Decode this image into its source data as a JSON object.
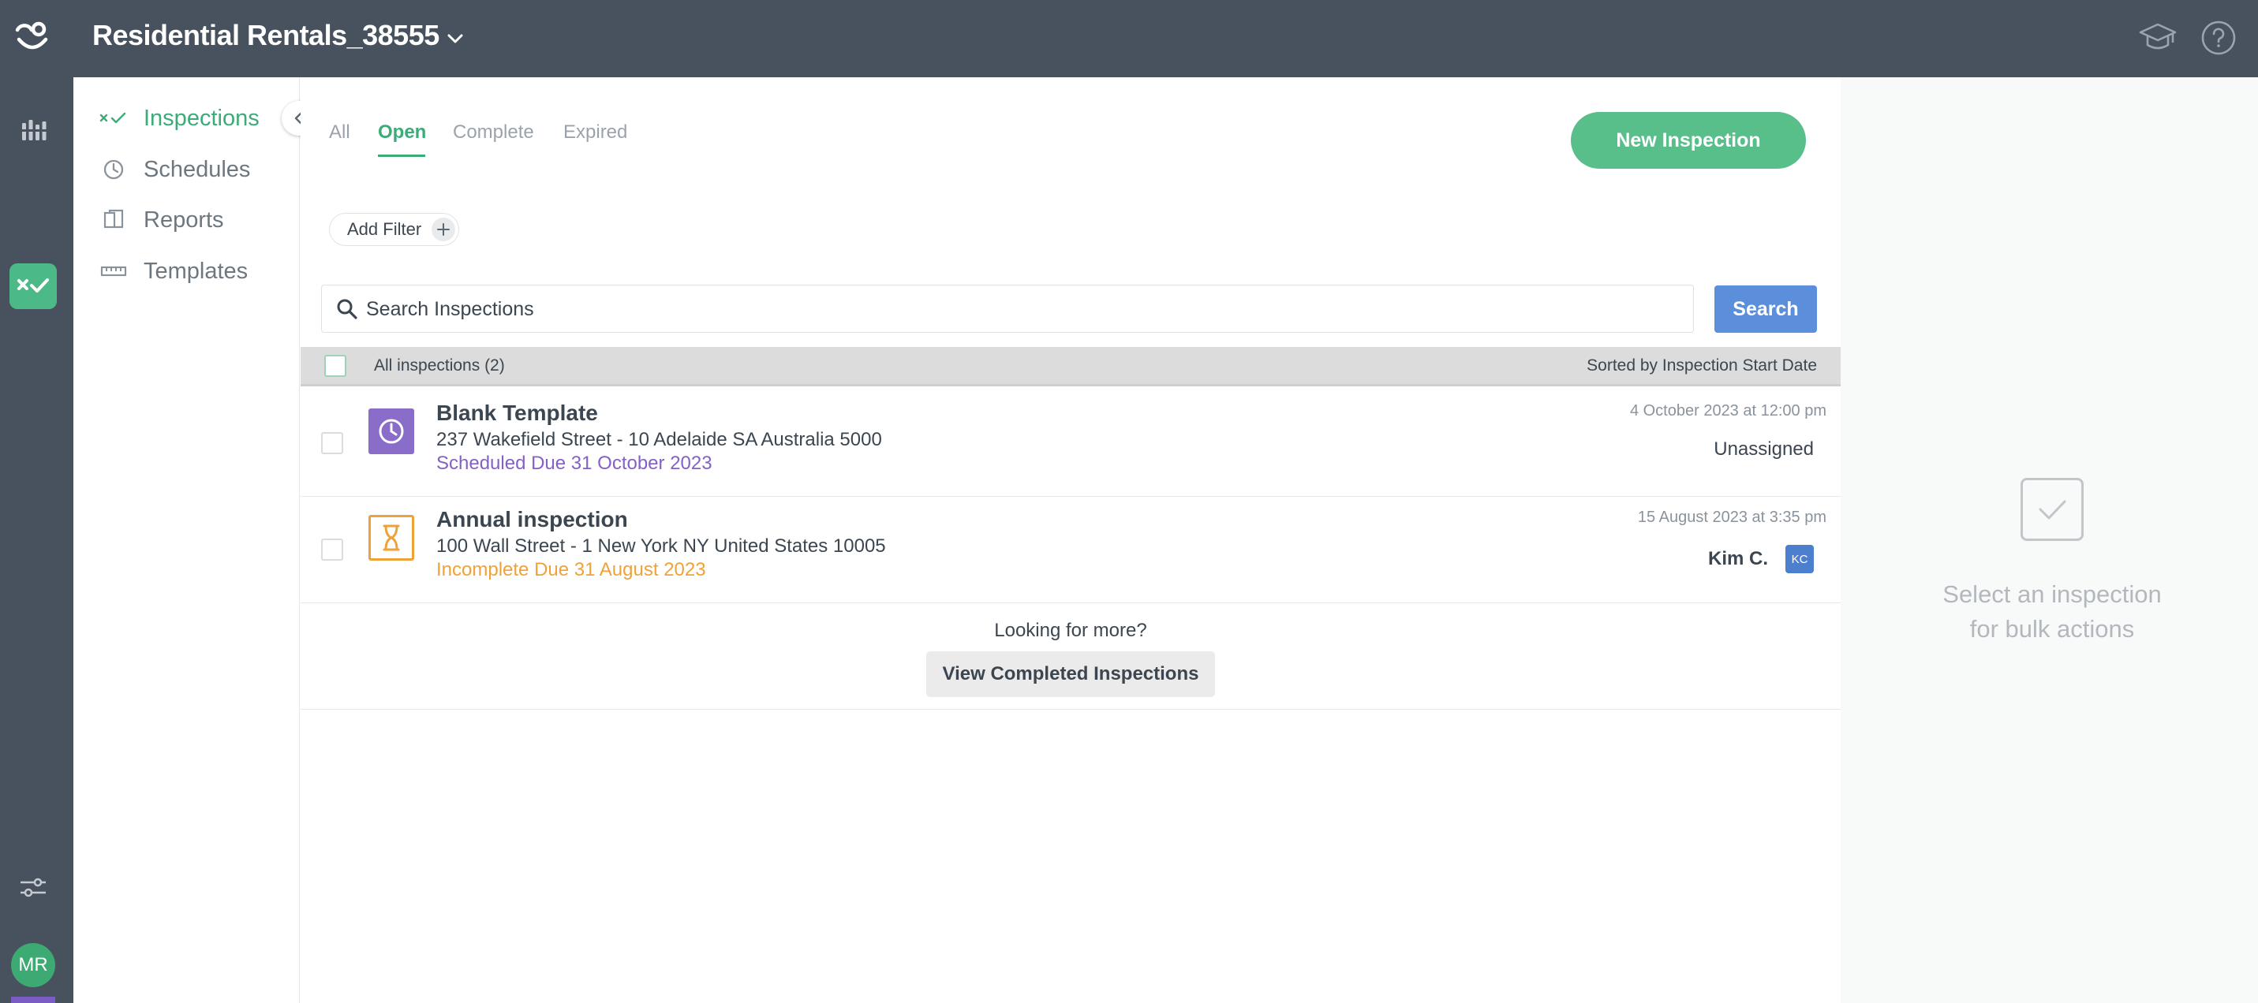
{
  "app": {
    "workspace_title": "Residential Rentals_38555"
  },
  "rail": {
    "avatar_initials": "MR"
  },
  "sidebar": {
    "items": [
      {
        "label": "Inspections",
        "icon": "inspections-icon",
        "active": true
      },
      {
        "label": "Schedules",
        "icon": "clock-icon",
        "active": false
      },
      {
        "label": "Reports",
        "icon": "reports-icon",
        "active": false
      },
      {
        "label": "Templates",
        "icon": "ruler-icon",
        "active": false
      }
    ]
  },
  "tabs": [
    {
      "label": "All",
      "active": false
    },
    {
      "label": "Open",
      "active": true
    },
    {
      "label": "Complete",
      "active": false
    },
    {
      "label": "Expired",
      "active": false
    }
  ],
  "actions": {
    "new_inspection": "New Inspection",
    "add_filter": "Add Filter",
    "search_placeholder": "Search Inspections",
    "search_button": "Search"
  },
  "list": {
    "count_label": "All inspections (2)",
    "sorted_label": "Sorted by Inspection Start Date",
    "rows": [
      {
        "title": "Blank Template",
        "address": "237 Wakefield Street - 10 Adelaide SA Australia 5000",
        "status": "Scheduled Due 31 October 2023",
        "status_color": "#8460c8",
        "date": "4 October 2023 at 12:00 pm",
        "assignee": "Unassigned",
        "icon": "clock-icon",
        "icon_color": "#8a6cc9"
      },
      {
        "title": "Annual inspection",
        "address": "100 Wall Street - 1 New York NY United States 10005",
        "status": "Incomplete Due 31 August 2023",
        "status_color": "#f0a23a",
        "date": "15 August 2023 at 3:35 pm",
        "assignee": "Kim C.",
        "assignee_badge": "KC",
        "icon": "hourglass-icon",
        "icon_color": "#f0a23a"
      }
    ]
  },
  "more": {
    "question": "Looking for more?",
    "button": "View Completed Inspections"
  },
  "bulk": {
    "line1": "Select an inspection",
    "line2": "for bulk actions"
  },
  "colors": {
    "topbar": "#48525e",
    "accent_green": "#3dab78",
    "search_blue": "#5b8fdb"
  }
}
